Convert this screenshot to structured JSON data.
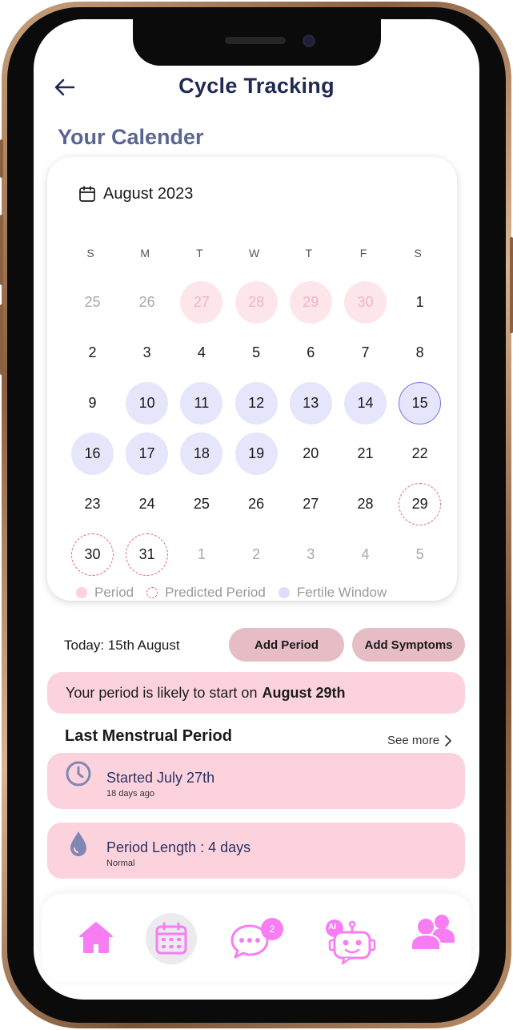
{
  "header": {
    "title": "Cycle Tracking",
    "section_title": "Your Calender"
  },
  "calendar": {
    "month_label": "August 2023",
    "weekdays": [
      "S",
      "M",
      "T",
      "W",
      "T",
      "F",
      "S"
    ],
    "weeks": [
      [
        {
          "d": "25",
          "s": "muted"
        },
        {
          "d": "26",
          "s": "muted"
        },
        {
          "d": "27",
          "s": "period"
        },
        {
          "d": "28",
          "s": "period"
        },
        {
          "d": "29",
          "s": "period"
        },
        {
          "d": "30",
          "s": "period"
        },
        {
          "d": "1",
          "s": ""
        }
      ],
      [
        {
          "d": "2",
          "s": ""
        },
        {
          "d": "3",
          "s": ""
        },
        {
          "d": "4",
          "s": ""
        },
        {
          "d": "5",
          "s": ""
        },
        {
          "d": "6",
          "s": ""
        },
        {
          "d": "7",
          "s": ""
        },
        {
          "d": "8",
          "s": ""
        }
      ],
      [
        {
          "d": "9",
          "s": ""
        },
        {
          "d": "10",
          "s": "fertile"
        },
        {
          "d": "11",
          "s": "fertile"
        },
        {
          "d": "12",
          "s": "fertile"
        },
        {
          "d": "13",
          "s": "fertile"
        },
        {
          "d": "14",
          "s": "fertile"
        },
        {
          "d": "15",
          "s": "today"
        }
      ],
      [
        {
          "d": "16",
          "s": "fertile"
        },
        {
          "d": "17",
          "s": "fertile"
        },
        {
          "d": "18",
          "s": "fertile"
        },
        {
          "d": "19",
          "s": "fertile"
        },
        {
          "d": "20",
          "s": ""
        },
        {
          "d": "21",
          "s": ""
        },
        {
          "d": "22",
          "s": ""
        }
      ],
      [
        {
          "d": "23",
          "s": ""
        },
        {
          "d": "24",
          "s": ""
        },
        {
          "d": "25",
          "s": ""
        },
        {
          "d": "26",
          "s": ""
        },
        {
          "d": "27",
          "s": ""
        },
        {
          "d": "28",
          "s": ""
        },
        {
          "d": "29",
          "s": "predicted"
        }
      ],
      [
        {
          "d": "30",
          "s": "predicted"
        },
        {
          "d": "31",
          "s": "predicted"
        },
        {
          "d": "1",
          "s": "muted"
        },
        {
          "d": "2",
          "s": "muted"
        },
        {
          "d": "3",
          "s": "muted"
        },
        {
          "d": "4",
          "s": "muted"
        },
        {
          "d": "5",
          "s": "muted"
        }
      ]
    ],
    "legend": {
      "period": "Period",
      "predicted": "Predicted Period",
      "fertile": "Fertile Window"
    }
  },
  "today": {
    "label": "Today: 15th August",
    "add_period_label": "Add Period",
    "add_symptoms_label": "Add Symptoms"
  },
  "prediction": {
    "text": "Your period is likely to start on",
    "date": "August 29th"
  },
  "last_period": {
    "title": "Last Menstrual Period",
    "see_more": "See more",
    "started": "Started July 27th",
    "started_sub": "18 days ago",
    "length": "Period Length : 4 days",
    "length_sub": "Normal"
  },
  "nav": {
    "items": [
      "home-icon",
      "calendar-icon",
      "chat-icon",
      "ai-robot-icon",
      "community-icon"
    ],
    "chat_badge": "2",
    "ai_badge": "AI"
  },
  "colors": {
    "accent_pink": "#f67ef2",
    "period_fill": "#fde6ea",
    "fertile_fill": "#e5e5fb",
    "predicted_border": "#e4647d",
    "card_pink": "#fcd3dc",
    "title_navy": "#212a54"
  }
}
